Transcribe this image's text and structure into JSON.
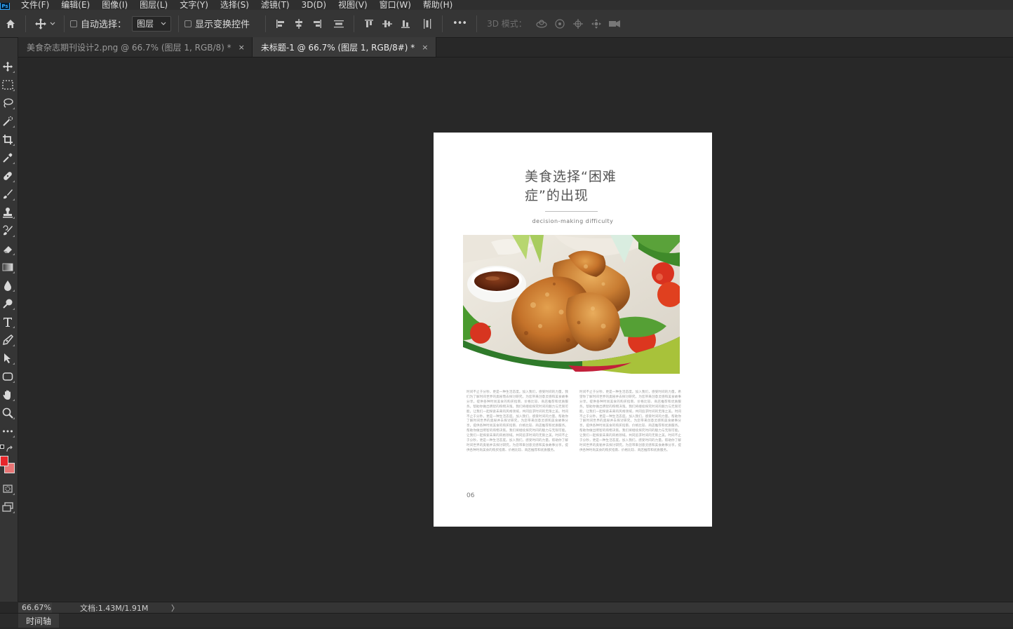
{
  "menu": {
    "app_badge": "Ps",
    "items": [
      "文件(F)",
      "编辑(E)",
      "图像(I)",
      "图层(L)",
      "文字(Y)",
      "选择(S)",
      "滤镜(T)",
      "3D(D)",
      "视图(V)",
      "窗口(W)",
      "帮助(H)"
    ]
  },
  "options": {
    "auto_select_label": "自动选择：",
    "auto_select_checked": false,
    "target_value": "图层",
    "show_transform_label": "显示变换控件",
    "show_transform_checked": false,
    "more_label": "•••",
    "mode3d_label": "3D 模式："
  },
  "tabs": [
    {
      "label": "美食杂志期刊设计2.png @ 66.7% (图层 1, RGB/8) *",
      "active": false,
      "close": "×"
    },
    {
      "label": "未标题-1 @ 66.7% (图层 1, RGB/8#) *",
      "active": true,
      "close": "×"
    }
  ],
  "document": {
    "title_line1": "美食选择“困难",
    "title_line2": "症”的出现",
    "subtitle": "decision-making difficulty",
    "body_left": "时间不止于分秒，更是一种生活态度。加入我们，感受时间的力量。我们为了解时间世界的奥秘而去探讨研究，为您带来创意灵感和美食故事分享。提供各种时尚美食的购买指南、价格比较、商店推荐和优质服务。帮助你做出明智的购物决策。我们将继续探究时间的魅力与无限可能，让我们一起探索未来的风格领域，共同追求时间的无限之美。时间不止于分秒，更是一种生活态度。加入我们，感受时间的力量。帮助你了解时间世界的奥秘并去探讨研究，为您带来创意灵感和美食故事分享。提供各种时尚美食的购买指南、价格比较、商店推荐和优质服务。帮助你做出明智的购物决策。我们将继续探究时间的魅力与无限可能。让我们一起探索未来的风格领域。共同追求时间的无限之美。时间不止于分秒，更是一种生活态度。加入我们，感受时间的力量。帮助你了解时间世界的奥秘并去探讨研究。为您带来创意灵感和美食故事分享。提供各种时尚美食的购买指南、价格比较、商店推荐和优质服务。",
    "body_right": "时间不止于分秒，更是一种生活态度。加入我们，感受时间的力量。希望你了解时间世界的奥秘并去探讨研究，为您带来创意灵感和美食故事分享。提供各种时尚美食的购买指南、价格比较、商店推荐和优质服务。帮助你做出明智的购物决策。我们将继续探究时间的魅力与无限可能，让我们一起探索未来的风格领域，共同追求时间的无限之美。时间不止于分秒，更是一种生活态度。加入我们，感受时间的力量。帮助你了解时间世界的奥秘并去探讨研究。为您带来创意灵感和美食故事分享。提供各种时尚美食的购买指南、价格比较、商店推荐和优质服务。帮助你做出明智的购物决策。我们将继续探究时间的魅力与无限可能。让我们一起探索未来的风格领域。共同追求时间的无限之美。时间不止于分秒，更是一种生活态度。加入我们，感受时间的力量。帮助你了解时间世界的奥秘并去探讨研究。为您带来创意灵感和美食故事分享。提供各种时尚美食的购买指南、价格比较、商店推荐和优质服务。",
    "page_number": "06"
  },
  "status": {
    "zoom": "66.67%",
    "doc_info": "文档:1.43M/1.91M",
    "arrow": "〉"
  },
  "timeline": {
    "tab_label": "时间轴"
  },
  "colors": {
    "foreground": "#e8262b",
    "background": "#e87474",
    "accent": "#31a8ff"
  }
}
